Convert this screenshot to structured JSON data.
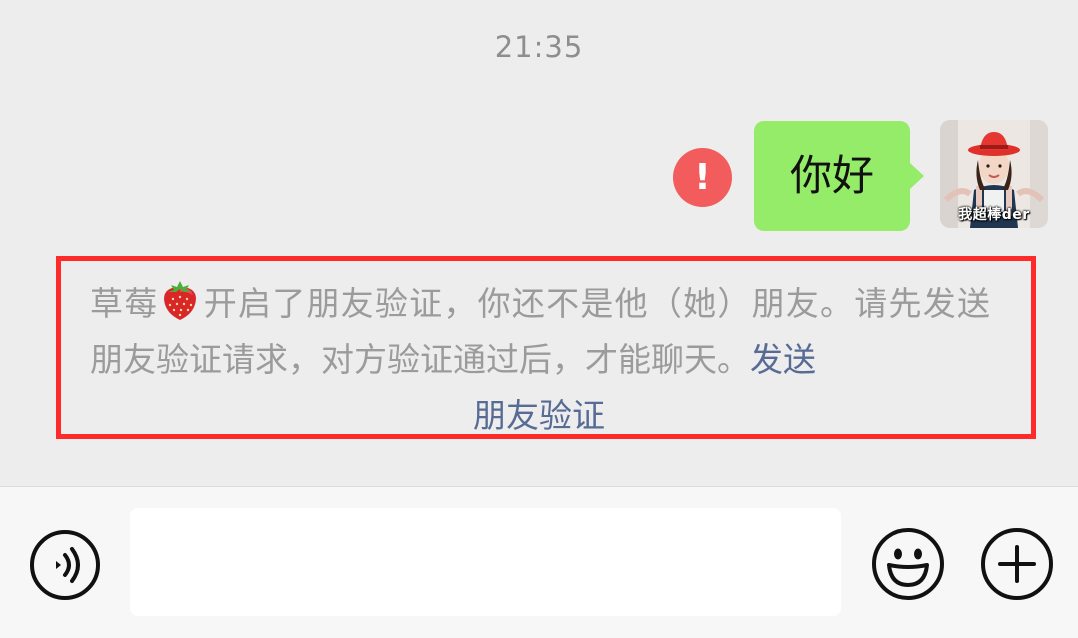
{
  "chat": {
    "timestamp": "21:35",
    "message": {
      "text": "你好",
      "status_icon": "error-exclamation-icon",
      "status_glyph": "!",
      "bubble_color": "#95ec69"
    },
    "avatar": {
      "caption": "我超棒der"
    },
    "system_notice": {
      "part1": "草莓",
      "emoji": "strawberry",
      "part2": "开启了朋友验证，你还不是他（她）朋友。请先发送朋友验证请求，对方验证通过后，才能聊天。",
      "link_part1": "发送",
      "link_part2": "朋友验证",
      "text_color": "#9b9b9b",
      "link_color": "#576b95",
      "highlight_color": "#ff2a2a"
    }
  },
  "input_bar": {
    "voice_icon": "voice-icon",
    "input_value": "",
    "emoji_icon": "emoji-icon",
    "plus_icon": "plus-icon"
  }
}
